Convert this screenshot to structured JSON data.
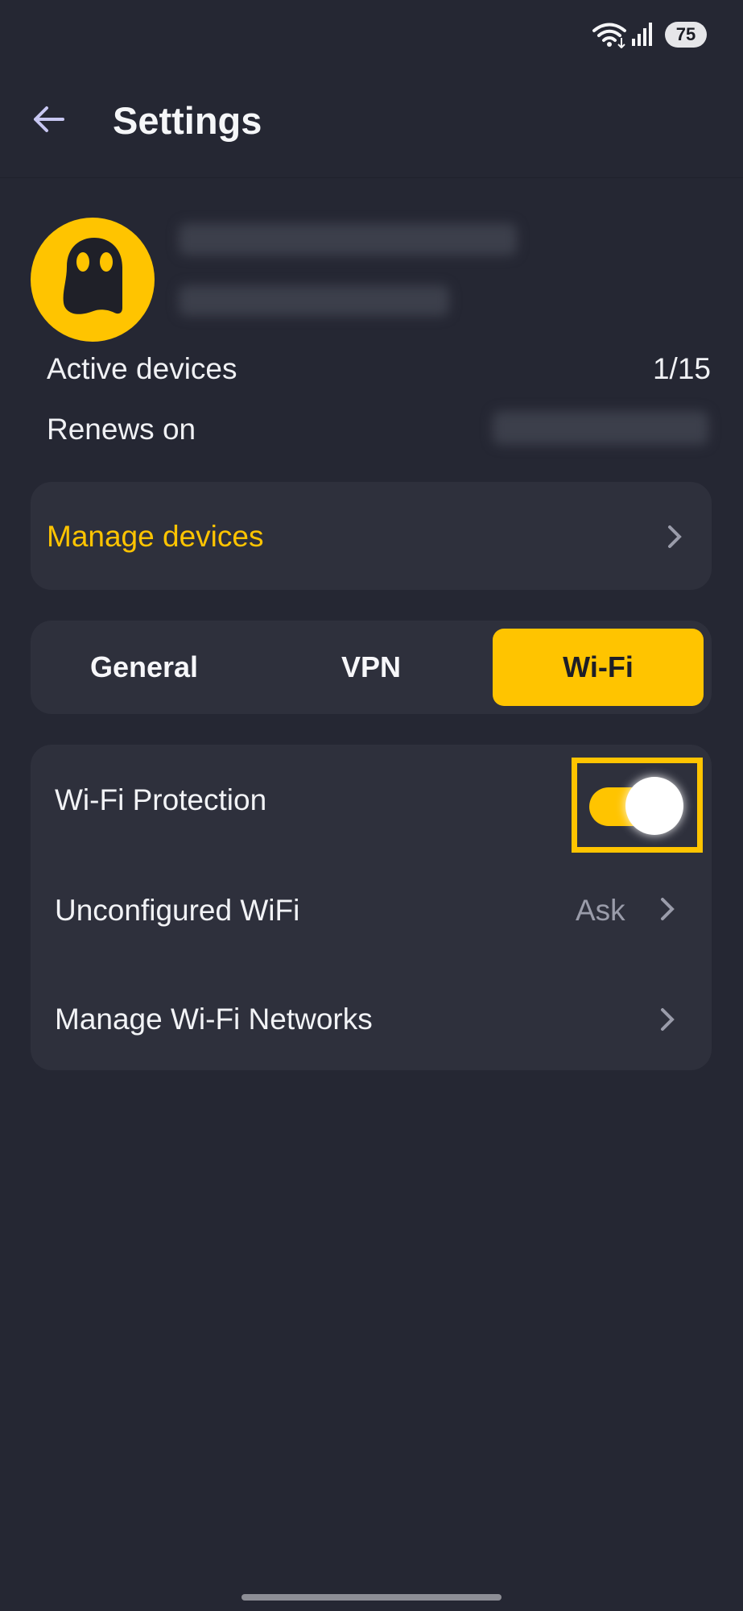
{
  "status_bar": {
    "battery": "75",
    "icons": [
      "wifi-icon",
      "signal-icon"
    ]
  },
  "header": {
    "title": "Settings",
    "back_icon": "arrow-left-icon"
  },
  "account": {
    "active_devices_label": "Active devices",
    "active_devices_value": "1/15",
    "renews_on_label": "Renews on"
  },
  "manage_devices": {
    "label": "Manage devices"
  },
  "tabs": [
    {
      "label": "General",
      "selected": false
    },
    {
      "label": "VPN",
      "selected": false
    },
    {
      "label": "Wi-Fi",
      "selected": true
    }
  ],
  "wifi_settings": {
    "wifi_protection": {
      "label": "Wi-Fi Protection",
      "enabled": true
    },
    "unconfigured_wifi": {
      "label": "Unconfigured WiFi",
      "value": "Ask"
    },
    "manage_networks": {
      "label": "Manage Wi-Fi Networks"
    }
  },
  "colors": {
    "background": "#252733",
    "card": "#2E303C",
    "accent": "#FFC400",
    "muted_text": "#9A9CAA"
  }
}
